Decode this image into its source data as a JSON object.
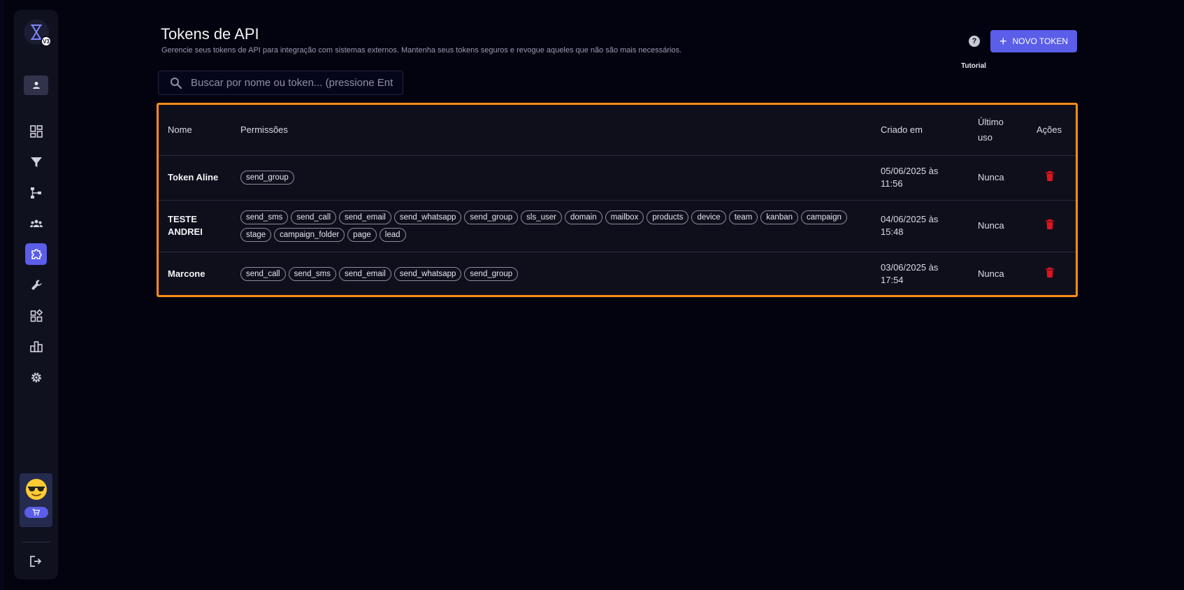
{
  "header": {
    "title": "Tokens de API",
    "subtitle": "Gerencie seus tokens de API para integração com sistemas externos. Mantenha seus tokens seguros e revogue aqueles que não são mais necessários.",
    "help_symbol": "?",
    "tutorial_label": "Tutorial",
    "new_token_label": "NOVO TOKEN",
    "plus_symbol": "+"
  },
  "logo": {
    "badge": "V3"
  },
  "search": {
    "placeholder": "Buscar por nome ou token... (pressione Enter)"
  },
  "sidebar": {
    "items": [
      {
        "icon": "dashboard-icon"
      },
      {
        "icon": "filter-icon"
      },
      {
        "icon": "flow-icon"
      },
      {
        "icon": "users-icon"
      },
      {
        "icon": "puzzle-icon",
        "active": true
      },
      {
        "icon": "wrench-icon"
      },
      {
        "icon": "widgets-icon"
      },
      {
        "icon": "bar-chart-icon"
      },
      {
        "icon": "gear-icon"
      }
    ]
  },
  "table": {
    "headers": {
      "name": "Nome",
      "permissions": "Permissões",
      "created": "Criado em",
      "last_use": "Último uso",
      "actions": "Ações"
    },
    "rows": [
      {
        "name": "Token Aline",
        "permissions": [
          "send_group"
        ],
        "created": "05/06/2025 às 11:56",
        "last_use": "Nunca"
      },
      {
        "name": "TESTE ANDREI",
        "permissions": [
          "send_sms",
          "send_call",
          "send_email",
          "send_whatsapp",
          "send_group",
          "sls_user",
          "domain",
          "mailbox",
          "products",
          "device",
          "team",
          "kanban",
          "campaign",
          "stage",
          "campaign_folder",
          "page",
          "lead"
        ],
        "created": "04/06/2025 às 15:48",
        "last_use": "Nunca"
      },
      {
        "name": "Marcone",
        "permissions": [
          "send_call",
          "send_sms",
          "send_email",
          "send_whatsapp",
          "send_group"
        ],
        "created": "03/06/2025 às 17:54",
        "last_use": "Nunca"
      }
    ]
  },
  "colors": {
    "accent": "#5a5ee8",
    "highlight_border": "#ff8c1a",
    "danger": "#e0141e",
    "background": "#03030f"
  }
}
